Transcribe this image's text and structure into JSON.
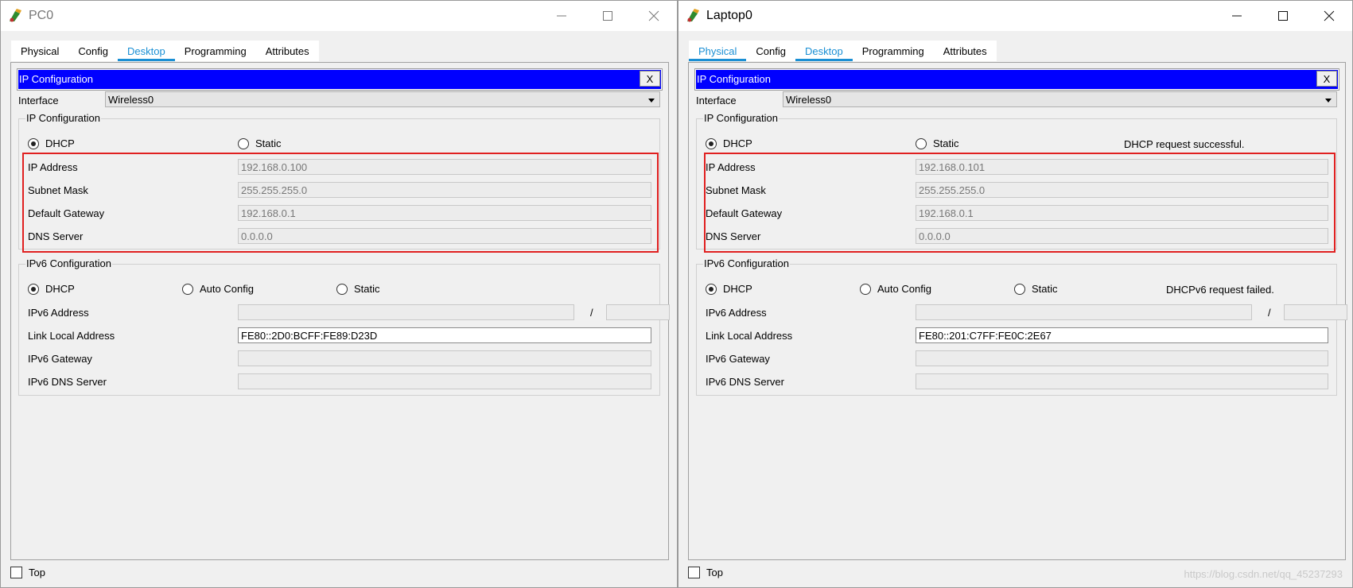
{
  "windows": [
    {
      "title": "PC0",
      "tabs": [
        "Physical",
        "Config",
        "Desktop",
        "Programming",
        "Attributes"
      ],
      "active_tab": "Desktop",
      "panel_title": "IP Configuration",
      "close_label": "X",
      "interface_label": "Interface",
      "interface_value": "Wireless0",
      "ipv4_group_title": "IP Configuration",
      "ipv4_mode_dhcp": "DHCP",
      "ipv4_mode_static": "Static",
      "ipv4_status": "",
      "ip_address_label": "IP Address",
      "ip_address": "192.168.0.100",
      "subnet_mask_label": "Subnet Mask",
      "subnet_mask": "255.255.255.0",
      "gateway_label": "Default Gateway",
      "gateway": "192.168.0.1",
      "dns_label": "DNS Server",
      "dns": "0.0.0.0",
      "ipv6_group_title": "IPv6 Configuration",
      "ipv6_mode_dhcp": "DHCP",
      "ipv6_mode_auto": "Auto Config",
      "ipv6_mode_static": "Static",
      "ipv6_status": "",
      "ipv6_address_label": "IPv6 Address",
      "ipv6_address": "",
      "ipv6_prefix_sep": "/",
      "ipv6_prefix": "",
      "link_local_label": "Link Local Address",
      "link_local": "FE80::2D0:BCFF:FE89:D23D",
      "ipv6_gateway_label": "IPv6 Gateway",
      "ipv6_gateway": "",
      "ipv6_dns_label": "IPv6 DNS Server",
      "ipv6_dns": "",
      "top_label": "Top"
    },
    {
      "title": "Laptop0",
      "tabs": [
        "Physical",
        "Config",
        "Desktop",
        "Programming",
        "Attributes"
      ],
      "active_tab": "Desktop",
      "panel_title": "IP Configuration",
      "close_label": "X",
      "interface_label": "Interface",
      "interface_value": "Wireless0",
      "ipv4_group_title": "IP Configuration",
      "ipv4_mode_dhcp": "DHCP",
      "ipv4_mode_static": "Static",
      "ipv4_status": "DHCP request successful.",
      "ip_address_label": "IP Address",
      "ip_address": "192.168.0.101",
      "subnet_mask_label": "Subnet Mask",
      "subnet_mask": "255.255.255.0",
      "gateway_label": "Default Gateway",
      "gateway": "192.168.0.1",
      "dns_label": "DNS Server",
      "dns": "0.0.0.0",
      "ipv6_group_title": "IPv6 Configuration",
      "ipv6_mode_dhcp": "DHCP",
      "ipv6_mode_auto": "Auto Config",
      "ipv6_mode_static": "Static",
      "ipv6_status": "DHCPv6 request failed.",
      "ipv6_address_label": "IPv6 Address",
      "ipv6_address": "",
      "ipv6_prefix_sep": "/",
      "ipv6_prefix": "",
      "link_local_label": "Link Local Address",
      "link_local": "FE80::201:C7FF:FE0C:2E67",
      "ipv6_gateway_label": "IPv6 Gateway",
      "ipv6_gateway": "",
      "ipv6_dns_label": "IPv6 DNS Server",
      "ipv6_dns": "",
      "top_label": "Top"
    }
  ],
  "watermark": "https://blog.csdn.net/qq_45237293",
  "colors": {
    "panel_title_bar": "#0000ff",
    "active_tab": "#1a8fd4",
    "highlight_box": "#e02020"
  },
  "icons": [
    "packet-tracer-app-icon",
    "minimize-icon",
    "maximize-icon",
    "close-icon"
  ]
}
